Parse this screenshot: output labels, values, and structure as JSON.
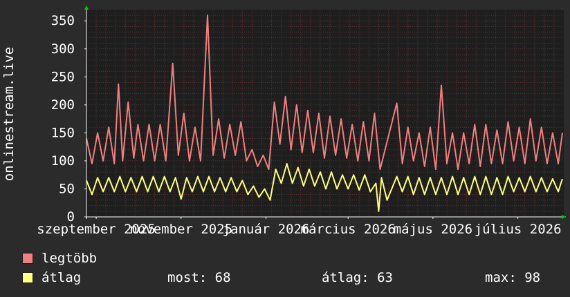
{
  "chart_data": {
    "type": "line",
    "ylabel": "onlinestream.live",
    "ylim": [
      0,
      370
    ],
    "yticks": [
      0,
      50,
      100,
      150,
      200,
      250,
      300,
      350
    ],
    "x_range": [
      "2025-08-25",
      "2026-08-03"
    ],
    "xticks": [
      {
        "date": "2025-09-01",
        "label": "szeptember 2025"
      },
      {
        "date": "2025-11-01",
        "label": "november 2025"
      },
      {
        "date": "2026-01-01",
        "label": "január 2026"
      },
      {
        "date": "2026-03-01",
        "label": "március 2026"
      },
      {
        "date": "2026-05-01",
        "label": "május 2026"
      },
      {
        "date": "2026-07-01",
        "label": "július 2026"
      }
    ],
    "grid": true,
    "series": [
      {
        "name": "legtöbb",
        "color": "#f08080",
        "points": [
          [
            "2025-08-25",
            140
          ],
          [
            "2025-08-29",
            95
          ],
          [
            "2025-09-02",
            150
          ],
          [
            "2025-09-06",
            100
          ],
          [
            "2025-09-10",
            160
          ],
          [
            "2025-09-14",
            95
          ],
          [
            "2025-09-17",
            237
          ],
          [
            "2025-09-20",
            100
          ],
          [
            "2025-09-24",
            205
          ],
          [
            "2025-09-28",
            105
          ],
          [
            "2025-10-01",
            165
          ],
          [
            "2025-10-05",
            100
          ],
          [
            "2025-10-09",
            165
          ],
          [
            "2025-10-13",
            100
          ],
          [
            "2025-10-17",
            165
          ],
          [
            "2025-10-21",
            100
          ],
          [
            "2025-10-26",
            274
          ],
          [
            "2025-10-30",
            110
          ],
          [
            "2025-11-03",
            185
          ],
          [
            "2025-11-07",
            100
          ],
          [
            "2025-11-11",
            160
          ],
          [
            "2025-11-15",
            100
          ],
          [
            "2025-11-20",
            360
          ],
          [
            "2025-11-24",
            110
          ],
          [
            "2025-11-28",
            175
          ],
          [
            "2025-12-02",
            105
          ],
          [
            "2025-12-06",
            165
          ],
          [
            "2025-12-10",
            110
          ],
          [
            "2025-12-14",
            170
          ],
          [
            "2025-12-18",
            100
          ],
          [
            "2025-12-22",
            120
          ],
          [
            "2025-12-26",
            90
          ],
          [
            "2025-12-30",
            110
          ],
          [
            "2026-01-03",
            85
          ],
          [
            "2026-01-07",
            205
          ],
          [
            "2026-01-11",
            130
          ],
          [
            "2026-01-15",
            215
          ],
          [
            "2026-01-19",
            120
          ],
          [
            "2026-01-23",
            200
          ],
          [
            "2026-01-27",
            115
          ],
          [
            "2026-01-31",
            190
          ],
          [
            "2026-02-04",
            115
          ],
          [
            "2026-02-08",
            185
          ],
          [
            "2026-02-12",
            105
          ],
          [
            "2026-02-16",
            180
          ],
          [
            "2026-02-20",
            110
          ],
          [
            "2026-02-24",
            175
          ],
          [
            "2026-02-28",
            105
          ],
          [
            "2026-03-04",
            165
          ],
          [
            "2026-03-08",
            100
          ],
          [
            "2026-03-12",
            170
          ],
          [
            "2026-03-16",
            100
          ],
          [
            "2026-03-20",
            185
          ],
          [
            "2026-03-24",
            85
          ],
          [
            "2026-04-05",
            203
          ],
          [
            "2026-04-09",
            95
          ],
          [
            "2026-04-13",
            160
          ],
          [
            "2026-04-17",
            100
          ],
          [
            "2026-04-21",
            150
          ],
          [
            "2026-04-25",
            90
          ],
          [
            "2026-04-29",
            160
          ],
          [
            "2026-05-03",
            85
          ],
          [
            "2026-05-07",
            235
          ],
          [
            "2026-05-11",
            95
          ],
          [
            "2026-05-15",
            150
          ],
          [
            "2026-05-19",
            85
          ],
          [
            "2026-05-23",
            150
          ],
          [
            "2026-05-27",
            95
          ],
          [
            "2026-05-31",
            165
          ],
          [
            "2026-06-04",
            90
          ],
          [
            "2026-06-08",
            165
          ],
          [
            "2026-06-12",
            95
          ],
          [
            "2026-06-16",
            155
          ],
          [
            "2026-06-20",
            95
          ],
          [
            "2026-06-24",
            170
          ],
          [
            "2026-06-28",
            100
          ],
          [
            "2026-07-02",
            160
          ],
          [
            "2026-07-06",
            95
          ],
          [
            "2026-07-10",
            175
          ],
          [
            "2026-07-14",
            100
          ],
          [
            "2026-07-18",
            160
          ],
          [
            "2026-07-22",
            95
          ],
          [
            "2026-07-26",
            150
          ],
          [
            "2026-07-30",
            95
          ],
          [
            "2026-08-02",
            150
          ]
        ]
      },
      {
        "name": "átlag",
        "color": "#ffff80",
        "points": [
          [
            "2025-08-25",
            65
          ],
          [
            "2025-08-29",
            40
          ],
          [
            "2025-09-02",
            70
          ],
          [
            "2025-09-06",
            45
          ],
          [
            "2025-09-10",
            70
          ],
          [
            "2025-09-14",
            45
          ],
          [
            "2025-09-18",
            72
          ],
          [
            "2025-09-22",
            45
          ],
          [
            "2025-09-26",
            70
          ],
          [
            "2025-09-30",
            45
          ],
          [
            "2025-10-04",
            72
          ],
          [
            "2025-10-08",
            45
          ],
          [
            "2025-10-12",
            72
          ],
          [
            "2025-10-16",
            45
          ],
          [
            "2025-10-20",
            72
          ],
          [
            "2025-10-24",
            45
          ],
          [
            "2025-10-28",
            70
          ],
          [
            "2025-11-01",
            32
          ],
          [
            "2025-11-05",
            70
          ],
          [
            "2025-11-09",
            45
          ],
          [
            "2025-11-13",
            72
          ],
          [
            "2025-11-17",
            45
          ],
          [
            "2025-11-21",
            72
          ],
          [
            "2025-11-25",
            45
          ],
          [
            "2025-11-29",
            70
          ],
          [
            "2025-12-03",
            45
          ],
          [
            "2025-12-07",
            70
          ],
          [
            "2025-12-11",
            45
          ],
          [
            "2025-12-15",
            65
          ],
          [
            "2025-12-19",
            40
          ],
          [
            "2025-12-23",
            55
          ],
          [
            "2025-12-27",
            35
          ],
          [
            "2025-12-31",
            50
          ],
          [
            "2026-01-04",
            30
          ],
          [
            "2026-01-08",
            85
          ],
          [
            "2026-01-12",
            60
          ],
          [
            "2026-01-16",
            95
          ],
          [
            "2026-01-20",
            60
          ],
          [
            "2026-01-24",
            88
          ],
          [
            "2026-01-28",
            55
          ],
          [
            "2026-02-01",
            85
          ],
          [
            "2026-02-05",
            55
          ],
          [
            "2026-02-09",
            80
          ],
          [
            "2026-02-13",
            50
          ],
          [
            "2026-02-17",
            80
          ],
          [
            "2026-02-21",
            50
          ],
          [
            "2026-02-25",
            75
          ],
          [
            "2026-03-01",
            50
          ],
          [
            "2026-03-05",
            75
          ],
          [
            "2026-03-09",
            48
          ],
          [
            "2026-03-13",
            75
          ],
          [
            "2026-03-17",
            45
          ],
          [
            "2026-03-21",
            60
          ],
          [
            "2026-03-23",
            10
          ],
          [
            "2026-03-25",
            70
          ],
          [
            "2026-03-29",
            30
          ],
          [
            "2026-04-05",
            72
          ],
          [
            "2026-04-09",
            45
          ],
          [
            "2026-04-13",
            72
          ],
          [
            "2026-04-17",
            40
          ],
          [
            "2026-04-21",
            70
          ],
          [
            "2026-04-25",
            40
          ],
          [
            "2026-04-29",
            70
          ],
          [
            "2026-05-03",
            40
          ],
          [
            "2026-05-07",
            70
          ],
          [
            "2026-05-11",
            40
          ],
          [
            "2026-05-15",
            72
          ],
          [
            "2026-05-19",
            40
          ],
          [
            "2026-05-23",
            70
          ],
          [
            "2026-05-27",
            40
          ],
          [
            "2026-05-31",
            72
          ],
          [
            "2026-06-04",
            40
          ],
          [
            "2026-06-08",
            72
          ],
          [
            "2026-06-12",
            40
          ],
          [
            "2026-06-16",
            70
          ],
          [
            "2026-06-20",
            40
          ],
          [
            "2026-06-24",
            72
          ],
          [
            "2026-06-28",
            45
          ],
          [
            "2026-07-02",
            70
          ],
          [
            "2026-07-06",
            45
          ],
          [
            "2026-07-10",
            72
          ],
          [
            "2026-07-14",
            45
          ],
          [
            "2026-07-18",
            70
          ],
          [
            "2026-07-22",
            45
          ],
          [
            "2026-07-26",
            68
          ],
          [
            "2026-07-30",
            45
          ],
          [
            "2026-08-02",
            68
          ]
        ]
      }
    ],
    "legend_placement": "bottom-left"
  },
  "legend": {
    "items": [
      {
        "label": "legtöbb",
        "color": "#f08080"
      },
      {
        "label": "átlag",
        "color": "#ffff80"
      }
    ],
    "stats": {
      "current": "most: 68",
      "average": "átlag: 63",
      "max": "max: 98"
    }
  },
  "colors": {
    "background": "#2b2b2b",
    "plot_background": "#1e1e1e",
    "grid_minor": "#5a3030",
    "axis": "#ffffff",
    "arrow": "#00cc00"
  }
}
